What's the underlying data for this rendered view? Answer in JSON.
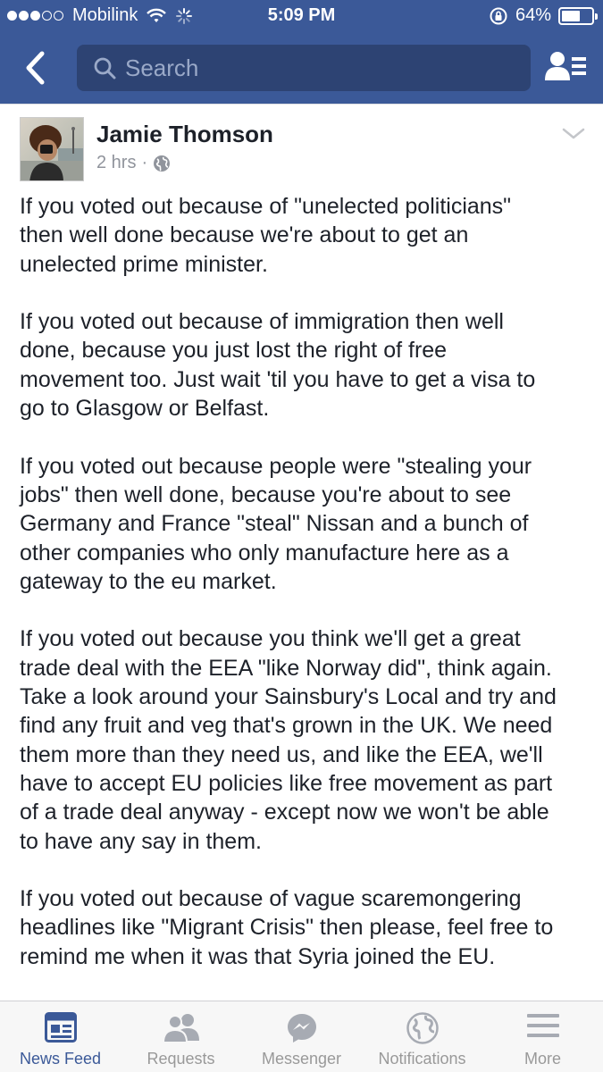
{
  "status_bar": {
    "carrier": "Mobilink",
    "time": "5:09 PM",
    "battery_percent": "64%",
    "battery_level": 0.64,
    "signal_bars_filled": 3,
    "signal_bars_total": 5
  },
  "nav": {
    "search_placeholder": "Search",
    "back_icon": "back-chevron-icon",
    "friends_icon": "friends-list-icon"
  },
  "post": {
    "author": "Jamie Thomson",
    "time_ago": "2 hrs",
    "separator": "·",
    "privacy_icon": "globe-icon",
    "paragraphs": [
      "If you voted out because of \"unelected politicians\"\nthen well done because we're about to get an\nunelected prime minister.",
      "If you voted out because of immigration then well\ndone, because you just lost the right of free\nmovement too. Just wait 'til you have to get a visa to\ngo to Glasgow or Belfast.",
      "If you voted out because people were \"stealing your\njobs\" then well done, because you're about to see\nGermany and France \"steal\" Nissan and a bunch of\nother companies who only manufacture here as a\ngateway to the eu market.",
      "If you voted out because you think we'll get a great\ntrade deal with the EEA \"like Norway did\", think again.\nTake a look around your Sainsbury's Local and try and\nfind any fruit and veg that's grown in the UK. We need\nthem more than they need us, and like the EEA, we'll\nhave to accept EU policies like free movement as part\nof a trade deal anyway - except now we won't be able\nto have any say in them.",
      "If you voted out because of vague scaremongering\nheadlines like \"Migrant Crisis\" then please, feel free to\nremind me when it was that Syria joined the EU."
    ]
  },
  "tabs": [
    {
      "label": "News Feed",
      "icon": "news-feed-icon",
      "active": true
    },
    {
      "label": "Requests",
      "icon": "friend-requests-icon",
      "active": false
    },
    {
      "label": "Messenger",
      "icon": "messenger-icon",
      "active": false
    },
    {
      "label": "Notifications",
      "icon": "notifications-globe-icon",
      "active": false
    },
    {
      "label": "More",
      "icon": "more-menu-icon",
      "active": false
    }
  ],
  "colors": {
    "brand_blue": "#3b5998",
    "search_bg": "#2d4373",
    "inactive_tab": "#999999",
    "meta_gray": "#90949c"
  }
}
